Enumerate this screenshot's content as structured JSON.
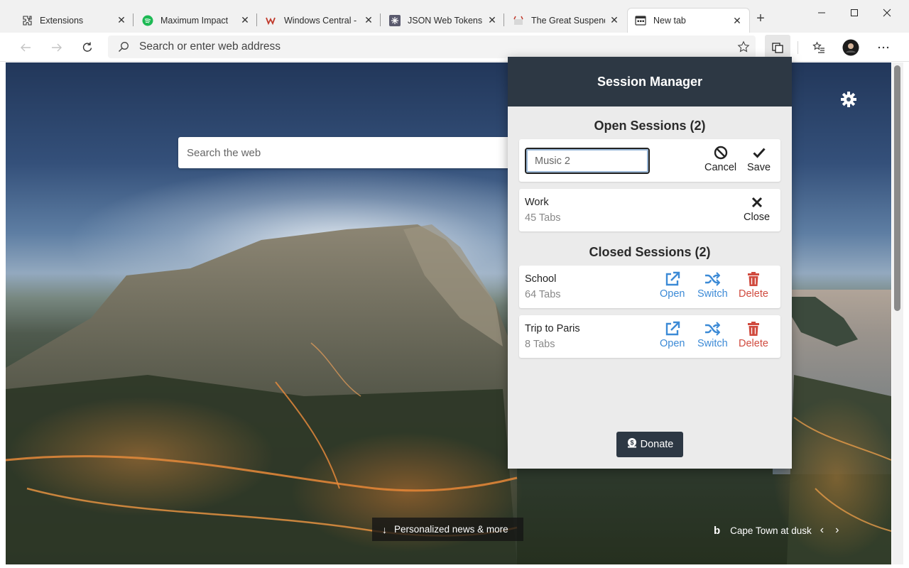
{
  "tabs": [
    {
      "title": "Extensions",
      "icon": "puzzle-icon"
    },
    {
      "title": "Maximum Impact",
      "icon": "spotify-icon"
    },
    {
      "title": "Windows Central - N",
      "icon": "windows-central-icon"
    },
    {
      "title": "JSON Web Tokens -",
      "icon": "jwt-icon"
    },
    {
      "title": "The Great Suspende",
      "icon": "suspender-icon"
    },
    {
      "title": "New tab",
      "icon": "newtab-icon",
      "active": true
    }
  ],
  "address_bar": {
    "placeholder": "Search or enter web address"
  },
  "newtab": {
    "search_placeholder": "Search the web",
    "news_button": "Personalized news & more",
    "photo_caption": "Cape Town at dusk"
  },
  "session_manager": {
    "title": "Session Manager",
    "open_title": "Open Sessions (2)",
    "closed_title": "Closed Sessions (2)",
    "editing": {
      "value": "Music 2",
      "cancel_label": "Cancel",
      "save_label": "Save"
    },
    "open_sessions": [
      {
        "name": "Work",
        "count": "45 Tabs",
        "action": "Close"
      }
    ],
    "closed_sessions": [
      {
        "name": "School",
        "count": "64 Tabs",
        "open": "Open",
        "switch": "Switch",
        "delete": "Delete"
      },
      {
        "name": "Trip to Paris",
        "count": "8 Tabs",
        "open": "Open",
        "switch": "Switch",
        "delete": "Delete"
      }
    ],
    "donate_label": "Donate"
  },
  "colors": {
    "header": "#2d3844",
    "action_blue": "#3c8ad6",
    "action_red": "#d04a3e"
  }
}
